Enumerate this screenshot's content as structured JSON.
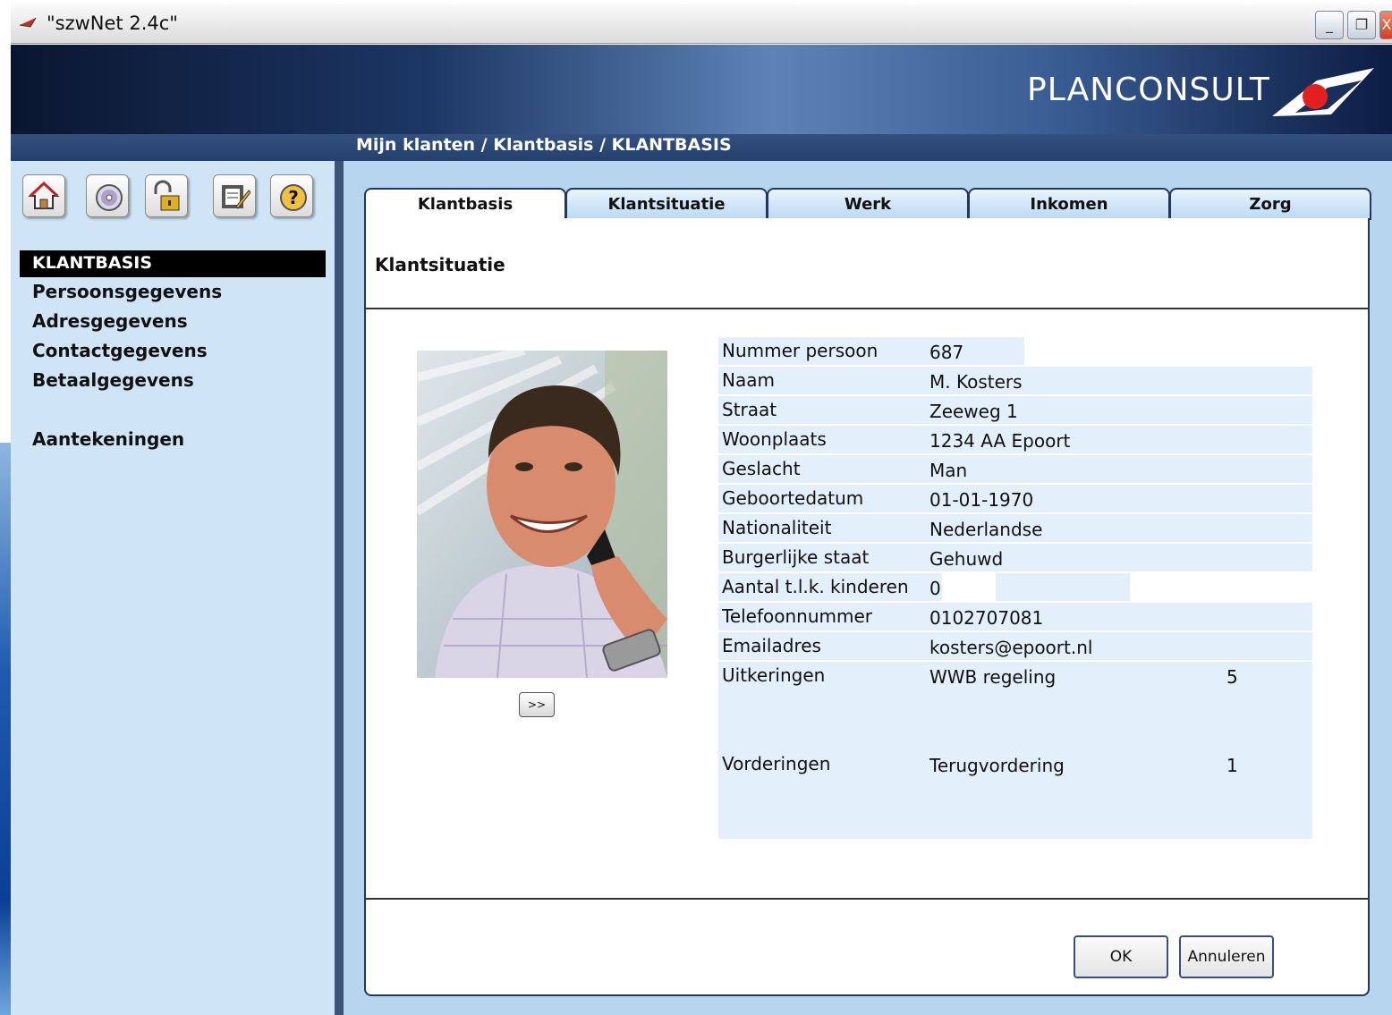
{
  "window": {
    "title": "\"szwNet 2.4c\"",
    "controls": [
      "minimize-icon",
      "restore-icon",
      "close-icon"
    ]
  },
  "banner": {
    "logo_text": "PLANCONSULT",
    "breadcrumb": "Mijn klanten / Klantbasis / KLANTBASIS"
  },
  "toolbar": {
    "icons": [
      "home-icon",
      "disc-icon",
      "lock-icon",
      "notepad-icon",
      "help-icon"
    ]
  },
  "sidebar": {
    "active_item": "KLANTBASIS",
    "items": [
      "Persoonsgegevens",
      "Adresgegevens",
      "Contactgegevens",
      "Betaalgegevens"
    ],
    "notes_item": "Aantekeningen"
  },
  "tabs": [
    {
      "label": "Klantbasis",
      "active": true
    },
    {
      "label": "Klantsituatie",
      "active": false
    },
    {
      "label": "Werk",
      "active": false
    },
    {
      "label": "Inkomen",
      "active": false
    },
    {
      "label": "Zorg",
      "active": false
    }
  ],
  "panel": {
    "title": "Klantsituatie",
    "next_button": ">>",
    "fields": [
      {
        "label": "Nummer persoon",
        "value": "687"
      },
      {
        "label": "Naam",
        "value": "M.  Kosters"
      },
      {
        "label": "Straat",
        "value": "Zeeweg 1"
      },
      {
        "label": "Woonplaats",
        "value": "1234 AA Epoort"
      },
      {
        "label": "Geslacht",
        "value": "Man"
      },
      {
        "label": "Geboortedatum",
        "value": "01-01-1970"
      },
      {
        "label": "Nationaliteit",
        "value": "Nederlandse"
      },
      {
        "label": "Burgerlijke staat",
        "value": "Gehuwd"
      },
      {
        "label": "Aantal t.l.k. kinderen",
        "value": "0"
      },
      {
        "label": "Telefoonnummer",
        "value": "0102707081"
      },
      {
        "label": "Emailadres",
        "value": "kosters@epoort.nl"
      }
    ],
    "uitkeringen": {
      "label": "Uitkeringen",
      "value": "WWB regeling",
      "count": "5"
    },
    "vorderingen": {
      "label": "Vorderingen",
      "value": "Terugvordering",
      "count": "1"
    }
  },
  "buttons": {
    "ok": "OK",
    "cancel": "Annuleren"
  }
}
